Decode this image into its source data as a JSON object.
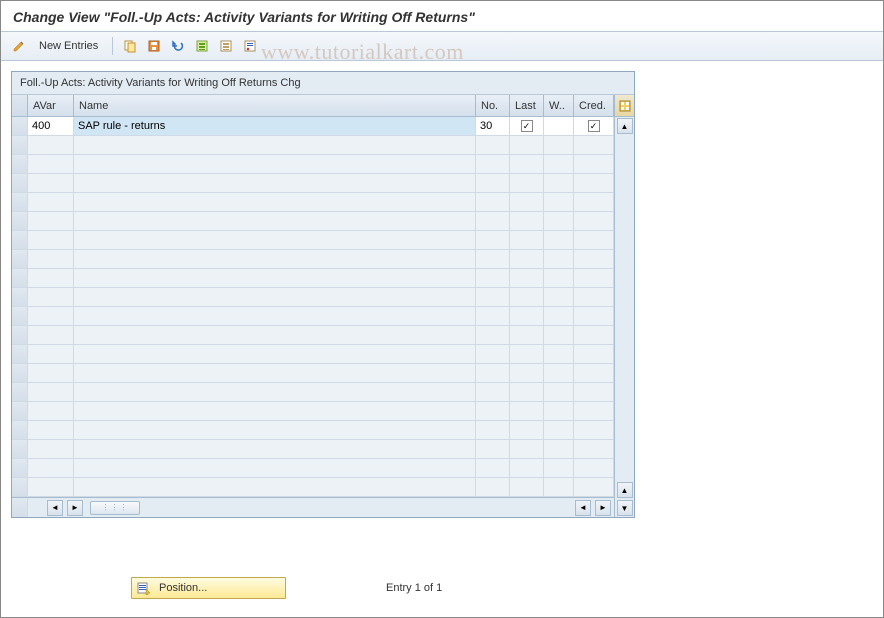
{
  "header": {
    "title": "Change View \"Foll.-Up Acts: Activity Variants for Writing Off Returns\""
  },
  "toolbar": {
    "new_entries": "New Entries"
  },
  "watermark": "www.tutorialkart.com",
  "table": {
    "title": "Foll.-Up Acts: Activity Variants for Writing Off Returns Chg",
    "columns": {
      "avar": "AVar",
      "name": "Name",
      "no": "No.",
      "last": "Last",
      "w": "W..",
      "cred": "Cred."
    },
    "rows": [
      {
        "avar": "400",
        "name": "SAP rule - returns",
        "no": "30",
        "last": true,
        "w": false,
        "cred": true
      }
    ]
  },
  "footer": {
    "position_label": "Position...",
    "entry_text": "Entry 1 of 1"
  }
}
